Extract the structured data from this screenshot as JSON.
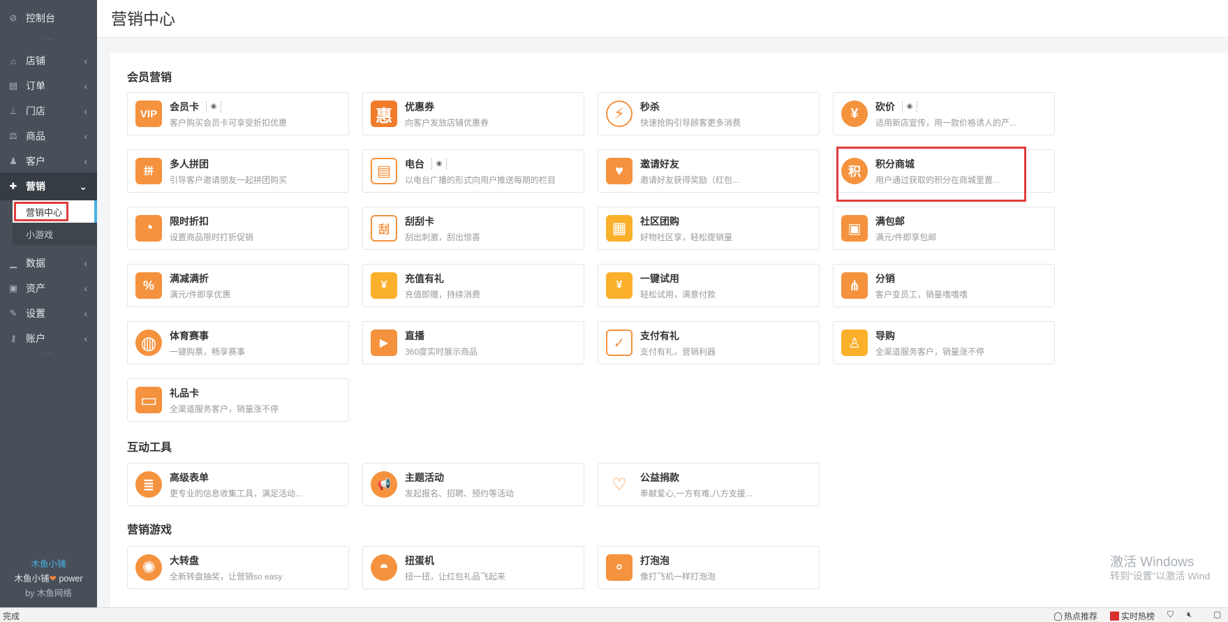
{
  "header": {
    "title": "营销中心"
  },
  "sidebar": {
    "console": "控制台",
    "dots": "···",
    "items": [
      {
        "label": "店铺",
        "icon": "store-icon"
      },
      {
        "label": "订单",
        "icon": "order-icon"
      },
      {
        "label": "门店",
        "icon": "branch-icon"
      },
      {
        "label": "商品",
        "icon": "scale-icon"
      },
      {
        "label": "客户",
        "icon": "users-icon"
      },
      {
        "label": "营销",
        "icon": "gift-icon"
      },
      {
        "label": "数据",
        "icon": "bar-chart-icon"
      },
      {
        "label": "资产",
        "icon": "money-icon"
      },
      {
        "label": "设置",
        "icon": "wrench-icon"
      },
      {
        "label": "账户",
        "icon": "key-icon"
      }
    ],
    "sub_items": [
      "营销中心",
      "小游戏"
    ],
    "brand": {
      "name": "木鱼小铺",
      "power_prefix": "木鱼小铺",
      "power_suffix": "power",
      "by": "by 木鱼网络"
    }
  },
  "sections": [
    {
      "title": "会员营销",
      "cards": [
        {
          "name": "会员卡",
          "desc": "客户购买会员卡可享受折扣优惠",
          "eye": true,
          "icon": "vip-card-icon",
          "glyph": "VIP"
        },
        {
          "name": "优惠券",
          "desc": "向客户发放店铺优惠券",
          "eye": false,
          "icon": "coupon-icon",
          "glyph": "惠"
        },
        {
          "name": "秒杀",
          "desc": "快速抢购引导顾客更多消费",
          "eye": false,
          "icon": "lightning-icon",
          "glyph": "⚡"
        },
        {
          "name": "砍价",
          "desc": "适用新店宣传，用一款价格诱人的产...",
          "eye": true,
          "icon": "bargain-icon",
          "glyph": "¥"
        },
        {
          "name": "多人拼团",
          "desc": "引导客户邀请朋友一起拼团购买",
          "eye": false,
          "icon": "group-buy-icon",
          "glyph": "拼"
        },
        {
          "name": "电台",
          "desc": "以电台广播的形式向用户推送每期的栏目",
          "eye": true,
          "icon": "radio-icon",
          "glyph": "▤"
        },
        {
          "name": "邀请好友",
          "desc": "邀请好友获得奖励（红包...",
          "eye": false,
          "icon": "invite-icon",
          "glyph": "♥"
        },
        {
          "name": "积分商城",
          "desc": "用户通过获取的积分在商城里置...",
          "eye": false,
          "icon": "points-mall-icon",
          "glyph": "积"
        },
        {
          "name": "限时折扣",
          "desc": "设置商品限时打折促销",
          "eye": false,
          "icon": "clock-icon",
          "glyph": "◔"
        },
        {
          "name": "刮刮卡",
          "desc": "刮出刺激，刮出惊喜",
          "eye": false,
          "icon": "scratch-card-icon",
          "glyph": "刮"
        },
        {
          "name": "社区团购",
          "desc": "好物社区享，轻松提销量",
          "eye": false,
          "icon": "community-icon",
          "glyph": "▦"
        },
        {
          "name": "满包邮",
          "desc": "满元/件即享包邮",
          "eye": false,
          "icon": "free-shipping-icon",
          "glyph": "▣"
        },
        {
          "name": "满减满折",
          "desc": "满元/件即享优惠",
          "eye": false,
          "icon": "percent-icon",
          "glyph": "%"
        },
        {
          "name": "充值有礼",
          "desc": "充值即赠，持续消费",
          "eye": false,
          "icon": "money-bag-icon",
          "glyph": "¥"
        },
        {
          "name": "一键试用",
          "desc": "轻松试用，满意付款",
          "eye": false,
          "icon": "trial-icon",
          "glyph": "¥"
        },
        {
          "name": "分销",
          "desc": "客户变员工，销量嗜嗜嗜",
          "eye": false,
          "icon": "distribution-icon",
          "glyph": "⋔"
        },
        {
          "name": "体育赛事",
          "desc": "一键购票，畅享赛事",
          "eye": false,
          "icon": "basketball-icon",
          "glyph": "◍"
        },
        {
          "name": "直播",
          "desc": "360度实时展示商品",
          "eye": false,
          "icon": "live-icon",
          "glyph": "▶"
        },
        {
          "name": "支付有礼",
          "desc": "支付有礼，营销利器",
          "eye": false,
          "icon": "pay-gift-icon",
          "glyph": "✓"
        },
        {
          "name": "导购",
          "desc": "全渠道服务客户，销量涨不停",
          "eye": false,
          "icon": "shopping-guide-icon",
          "glyph": "♙"
        },
        {
          "name": "礼品卡",
          "desc": "全渠道服务客户，销量涨不停",
          "eye": false,
          "icon": "gift-card-icon",
          "glyph": "▭"
        }
      ]
    },
    {
      "title": "互动工具",
      "cards": [
        {
          "name": "高级表单",
          "desc": "更专业的信息收集工具，满足活动...",
          "eye": false,
          "icon": "form-icon",
          "glyph": "≣"
        },
        {
          "name": "主题活动",
          "desc": "发起报名、招聘、预约等活动",
          "eye": false,
          "icon": "megaphone-icon",
          "glyph": "📢"
        },
        {
          "name": "公益捐款",
          "desc": "奉献爱心,一方有难,八方支援...",
          "eye": false,
          "icon": "charity-icon",
          "glyph": "♡"
        }
      ]
    },
    {
      "title": "营销游戏",
      "cards": [
        {
          "name": "大转盘",
          "desc": "全新转盘抽奖，让营销so easy",
          "eye": false,
          "icon": "wheel-icon",
          "glyph": "✺"
        },
        {
          "name": "扭蛋机",
          "desc": "扭一扭，让红包礼品飞起来",
          "eye": false,
          "icon": "gashapon-icon",
          "glyph": "◓"
        },
        {
          "name": "打泡泡",
          "desc": "像打飞机一样打泡泡",
          "eye": false,
          "icon": "bubble-icon",
          "glyph": "⚬"
        }
      ]
    }
  ],
  "watermark": {
    "line1": "激活 Windows",
    "line2": "转到“设置”以激活 Wind"
  },
  "statusbar": {
    "left": "完成",
    "hot": "热点推荐",
    "realtime": "实时热榜"
  },
  "colors": {
    "orange": "#f5923e",
    "deep_orange": "#f07c2a",
    "sidebar": "#474f58",
    "accent_blue": "#49b1e5",
    "highlight_red": "#e03c3c"
  }
}
